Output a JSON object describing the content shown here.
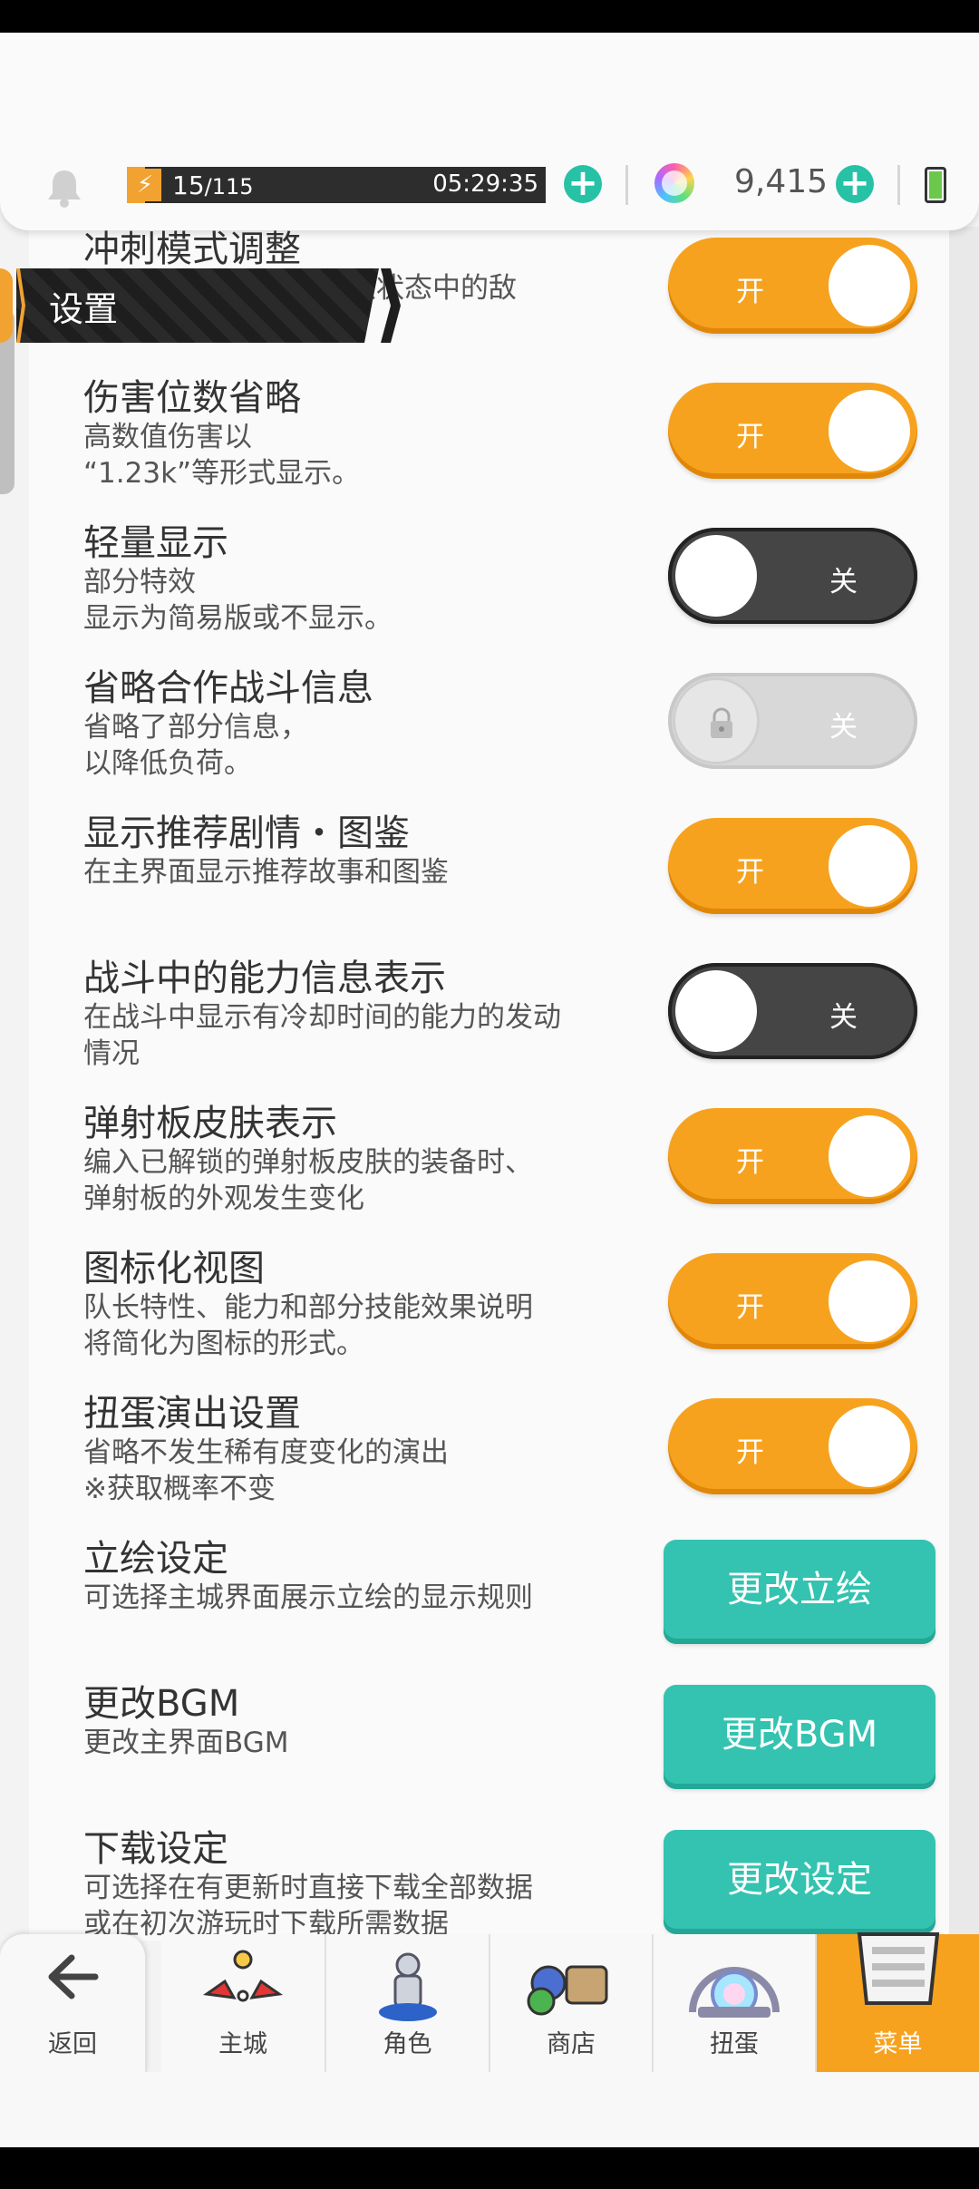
{
  "header": {
    "stamina_current": "15",
    "stamina_max": "/115",
    "stamina_timer": "05:29:35",
    "gems": "9,415"
  },
  "banner_title": "设置",
  "settings": [
    {
      "title": "冲刺模式调整",
      "desc": [
        "…于敌状态中的敌"
      ],
      "state": "开"
    },
    {
      "title": "伤害位数省略",
      "desc": [
        "高数值伤害以",
        "“1.23k”等形式显示。"
      ],
      "state": "开"
    },
    {
      "title": "轻量显示",
      "desc": [
        "部分特效",
        "显示为简易版或不显示。"
      ],
      "state": "关"
    },
    {
      "title": "省略合作战斗信息",
      "desc": [
        "省略了部分信息，",
        "以降低负荷。"
      ],
      "state": "关",
      "locked": true
    },
    {
      "title": "显示推荐剧情・图鉴",
      "desc": [
        "在主界面显示推荐故事和图鉴"
      ],
      "state": "开"
    },
    {
      "title": "战斗中的能力信息表示",
      "desc": [
        "在战斗中显示有冷却时间的能力的发动",
        "情况"
      ],
      "state": "关"
    },
    {
      "title": "弹射板皮肤表示",
      "desc": [
        "编入已解锁的弹射板皮肤的装备时、",
        "弹射板的外观发生变化"
      ],
      "state": "开"
    },
    {
      "title": "图标化视图",
      "desc": [
        "队长特性、能力和部分技能效果说明",
        "将简化为图标的形式。"
      ],
      "state": "开"
    },
    {
      "title": "扭蛋演出设置",
      "desc": [
        "省略不发生稀有度变化的演出",
        "※获取概率不变"
      ],
      "state": "开"
    },
    {
      "title": "立绘设定",
      "desc": [
        "可选择主城界面展示立绘的显示规则"
      ],
      "button": "更改立绘"
    },
    {
      "title": "更改BGM",
      "desc": [
        "更改主界面BGM"
      ],
      "button": "更改BGM"
    },
    {
      "title": "下载设定",
      "desc": [
        "可选择在有更新时直接下载全部数据",
        "或在初次游玩时下载所需数据"
      ],
      "button": "更改设定"
    }
  ],
  "nav": {
    "back": "返回",
    "home": "主城",
    "character": "角色",
    "shop": "商店",
    "gacha": "扭蛋",
    "menu": "菜单"
  },
  "colors": {
    "toggle_on": "#f7a21e",
    "toggle_off": "#454545",
    "action_button": "#33c3b0",
    "stamina": "#f2a230",
    "plus": "#27c2a6"
  }
}
